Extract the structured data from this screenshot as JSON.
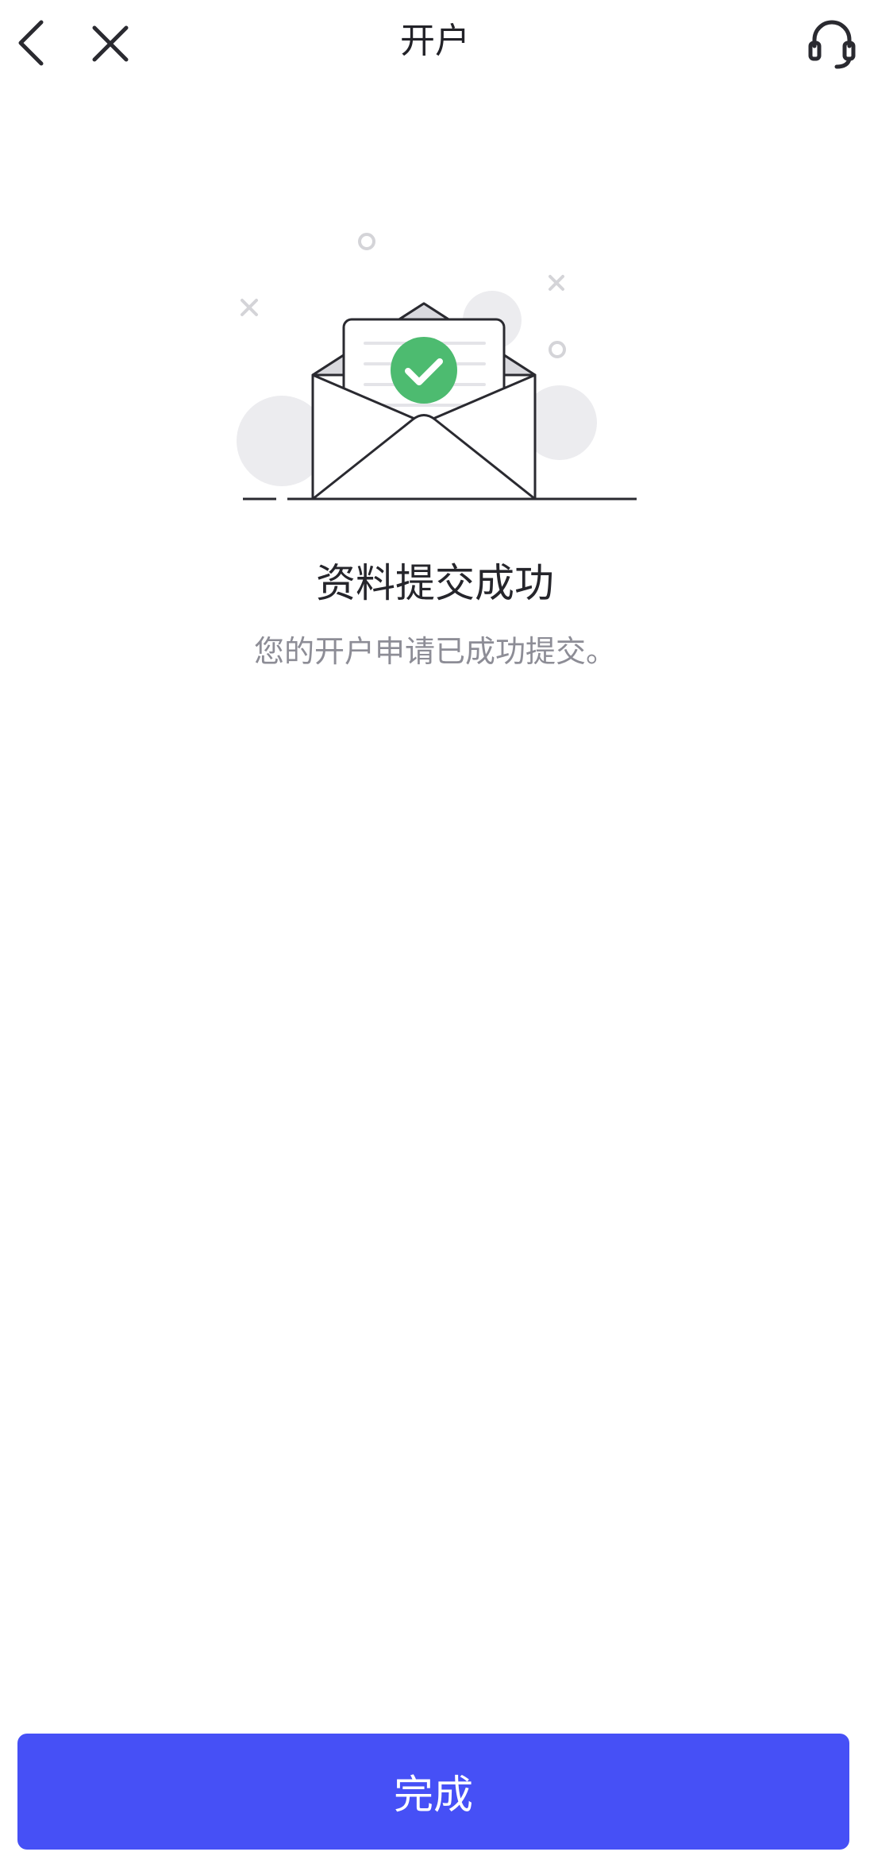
{
  "header": {
    "title": "开户",
    "back_icon": "chevron-left-icon",
    "close_icon": "close-icon",
    "support_icon": "headset-icon"
  },
  "result": {
    "title": "资料提交成功",
    "description": "您的开户申请已成功提交。",
    "illustration": "envelope-success-illustration",
    "status_color": "#4dbb70"
  },
  "footer": {
    "done_label": "完成",
    "button_color": "#4650f6"
  }
}
